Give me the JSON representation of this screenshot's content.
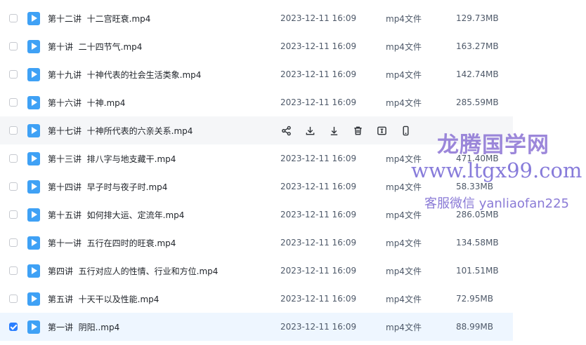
{
  "files": [
    {
      "name": "第十二讲  十二宫旺衰.mp4",
      "date": "2023-12-11 16:09",
      "type": "mp4文件",
      "size": "129.73MB",
      "checked": false,
      "state": "normal"
    },
    {
      "name": "第十讲  二十四节气.mp4",
      "date": "2023-12-11 16:09",
      "type": "mp4文件",
      "size": "163.27MB",
      "checked": false,
      "state": "normal"
    },
    {
      "name": "第十九讲  十神代表的社会生活类象.mp4",
      "date": "2023-12-11 16:09",
      "type": "mp4文件",
      "size": "142.74MB",
      "checked": false,
      "state": "normal"
    },
    {
      "name": "第十六讲  十神.mp4",
      "date": "2023-12-11 16:09",
      "type": "mp4文件",
      "size": "285.59MB",
      "checked": false,
      "state": "normal"
    },
    {
      "name": "第十七讲  十神所代表的六亲关系.mp4",
      "date": "",
      "type": "",
      "size": "",
      "checked": false,
      "state": "hover"
    },
    {
      "name": "第十三讲  排八字与地支藏干.mp4",
      "date": "2023-12-11 16:09",
      "type": "mp4文件",
      "size": "471.40MB",
      "checked": false,
      "state": "normal"
    },
    {
      "name": "第十四讲  早子时与夜子时.mp4",
      "date": "2023-12-11 16:09",
      "type": "mp4文件",
      "size": "58.33MB",
      "checked": false,
      "state": "normal"
    },
    {
      "name": "第十五讲  如何排大运、定流年.mp4",
      "date": "2023-12-11 16:09",
      "type": "mp4文件",
      "size": "286.05MB",
      "checked": false,
      "state": "normal"
    },
    {
      "name": "第十一讲  五行在四时的旺衰.mp4",
      "date": "2023-12-11 16:09",
      "type": "mp4文件",
      "size": "134.58MB",
      "checked": false,
      "state": "normal"
    },
    {
      "name": "第四讲  五行对应人的性情、行业和方位.mp4",
      "date": "2023-12-11 16:09",
      "type": "mp4文件",
      "size": "101.51MB",
      "checked": false,
      "state": "normal"
    },
    {
      "name": "第五讲  十天干以及性能.mp4",
      "date": "2023-12-11 16:09",
      "type": "mp4文件",
      "size": "72.95MB",
      "checked": false,
      "state": "normal"
    },
    {
      "name": "第一讲  阴阳..mp4",
      "date": "2023-12-11 16:09",
      "type": "mp4文件",
      "size": "88.99MB",
      "checked": true,
      "state": "selected"
    }
  ],
  "hover_actions": [
    "share-icon",
    "download-icon",
    "save-download-icon",
    "delete-icon",
    "rename-icon",
    "phone-icon"
  ],
  "watermark": {
    "line1": "龙腾国学网",
    "line2": "www.ltgx99.com",
    "line3": "客服微信 yanliaofan225"
  },
  "colors": {
    "accent": "#2b7fff",
    "file_icon": "#3fa1f5",
    "hover_row": "#f5f6f8",
    "selected_row": "#eef6ff"
  }
}
